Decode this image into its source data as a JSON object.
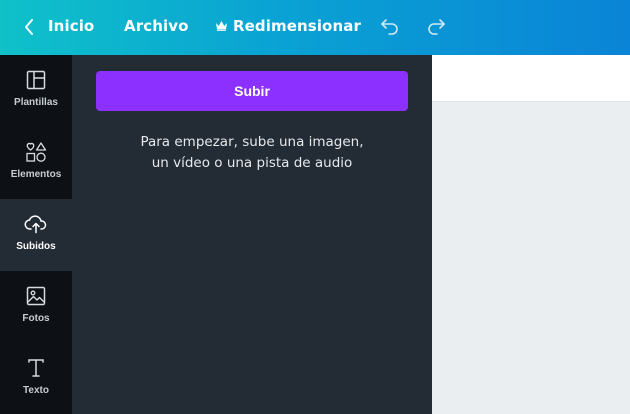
{
  "topbar": {
    "back_icon": "chevron-left-icon",
    "home_label": "Inicio",
    "file_label": "Archivo",
    "resize_icon": "crown-icon",
    "resize_label": "Redimensionar",
    "undo_icon": "undo-icon",
    "redo_icon": "redo-icon"
  },
  "sidebar": {
    "items": [
      {
        "label": "Plantillas",
        "icon": "templates-icon",
        "active": false
      },
      {
        "label": "Elementos",
        "icon": "shapes-icon",
        "active": false
      },
      {
        "label": "Subidos",
        "icon": "cloud-upload-icon",
        "active": true
      },
      {
        "label": "Fotos",
        "icon": "image-icon",
        "active": false
      },
      {
        "label": "Texto",
        "icon": "text-icon",
        "active": false
      }
    ]
  },
  "panel": {
    "upload_button_label": "Subir",
    "helper_line1": "Para empezar, sube una imagen,",
    "helper_line2": "un vídeo o una pista de audio"
  },
  "colors": {
    "topbar_gradient_start": "#0fc1c9",
    "topbar_gradient_end": "#0a84d6",
    "upload_button": "#8b30ff",
    "panel_bg": "#232b35",
    "rail_bg": "#0d1116"
  }
}
